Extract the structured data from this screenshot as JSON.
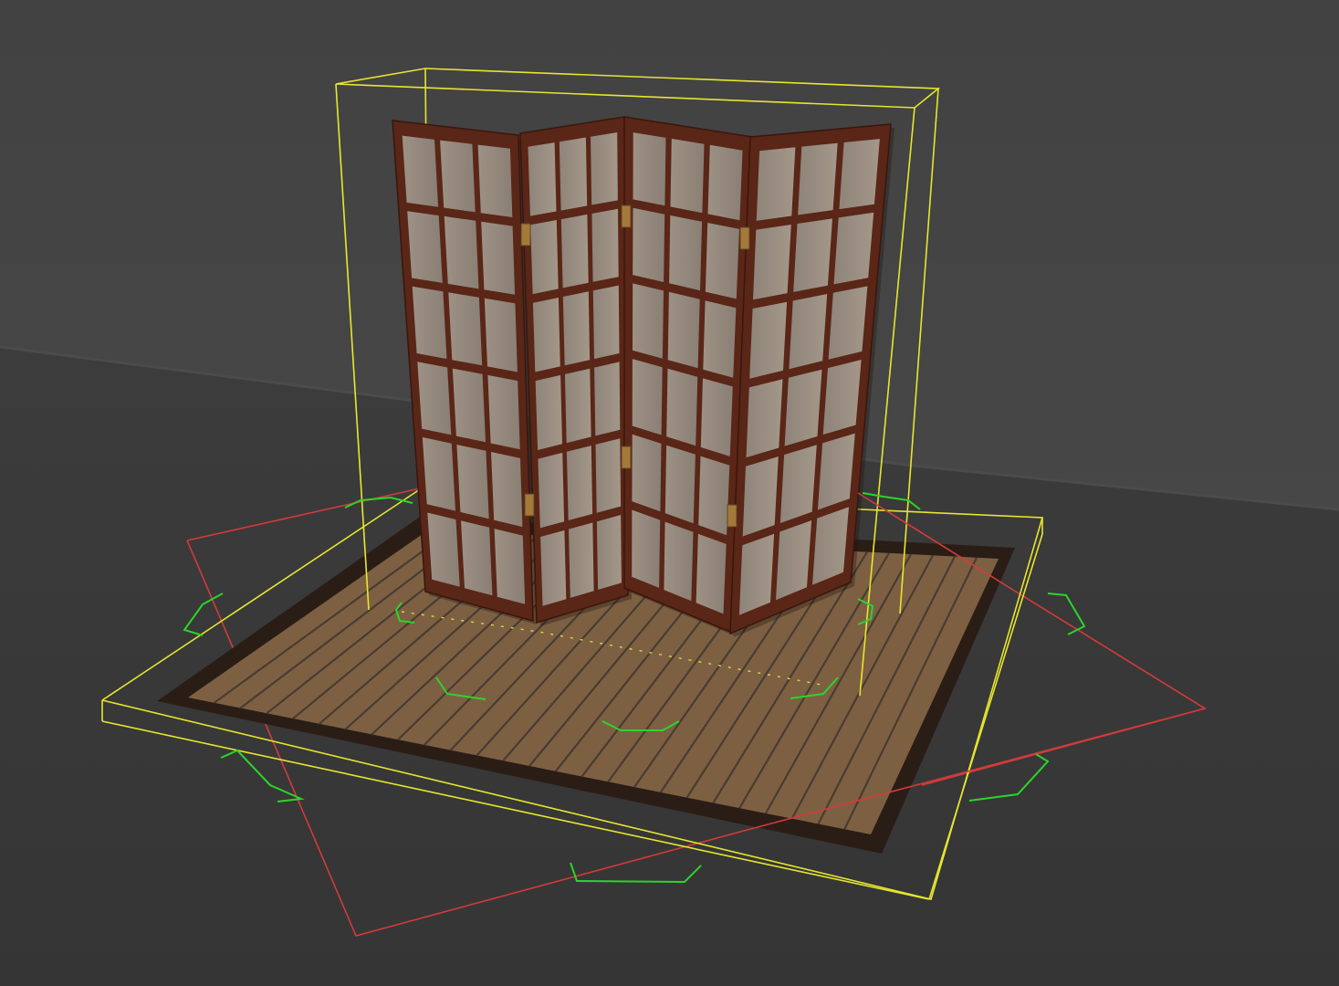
{
  "viewport": {
    "background_colors": {
      "wall": "#424242",
      "floor": "#3a3a3a",
      "floor_edge": "#4c4c4c"
    }
  },
  "scene_object": {
    "name": "",
    "type": "four-panel folding shoji screen on wooden platform",
    "panel_count": 4,
    "panel_frame_color": "#5a2617",
    "panel_paper_color": "#9a8d7f",
    "hinge_color": "#a37a3a",
    "platform_plank_color": "#7d6042",
    "platform_border_color": "#2a1d16"
  },
  "selection": {
    "bounding_box_color": "#e6e62e",
    "transform_gizmo_ring_color": "#d43a3a",
    "rotation_handle_color": "#2bd42b",
    "pivot_path_color": "#d8d84a"
  }
}
